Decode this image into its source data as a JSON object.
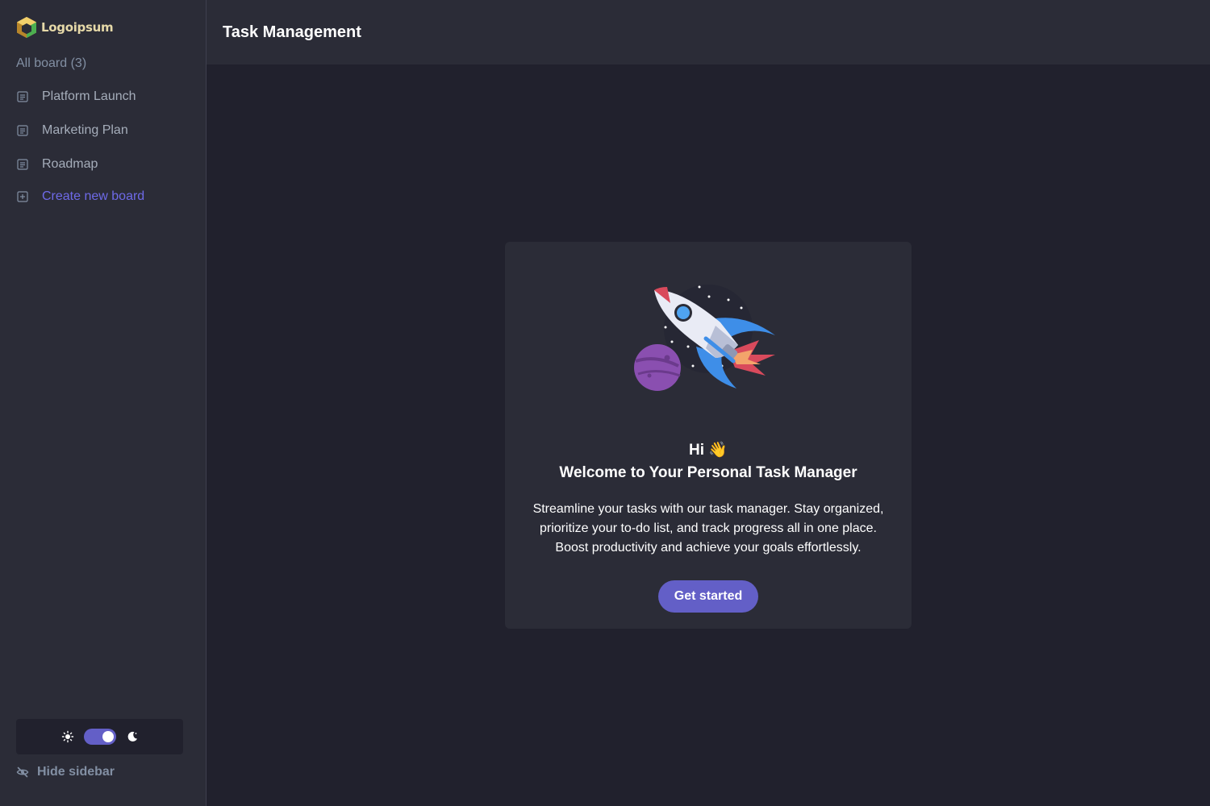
{
  "sidebar": {
    "logo_text": "Logoipsum",
    "board_count_label": "All board (3)",
    "boards": [
      {
        "label": "Platform Launch"
      },
      {
        "label": "Marketing Plan"
      },
      {
        "label": "Roadmap"
      }
    ],
    "create_label": "Create new board",
    "hide_label": "Hide sidebar",
    "theme": {
      "mode": "dark",
      "light_icon": "sun-icon",
      "dark_icon": "moon-icon"
    }
  },
  "header": {
    "title": "Task Management"
  },
  "welcome": {
    "greeting": "Hi 👋",
    "title": "Welcome to Your Personal Task Manager",
    "description": "Streamline your tasks with our task manager. Stay organized, prioritize your to-do list, and track progress all in one place. Boost productivity and achieve your goals effortlessly.",
    "cta_label": "Get started"
  },
  "colors": {
    "accent": "#635fc7",
    "sidebar_bg": "#2b2c37",
    "page_bg": "#21212d",
    "muted_text": "#828fa3"
  }
}
